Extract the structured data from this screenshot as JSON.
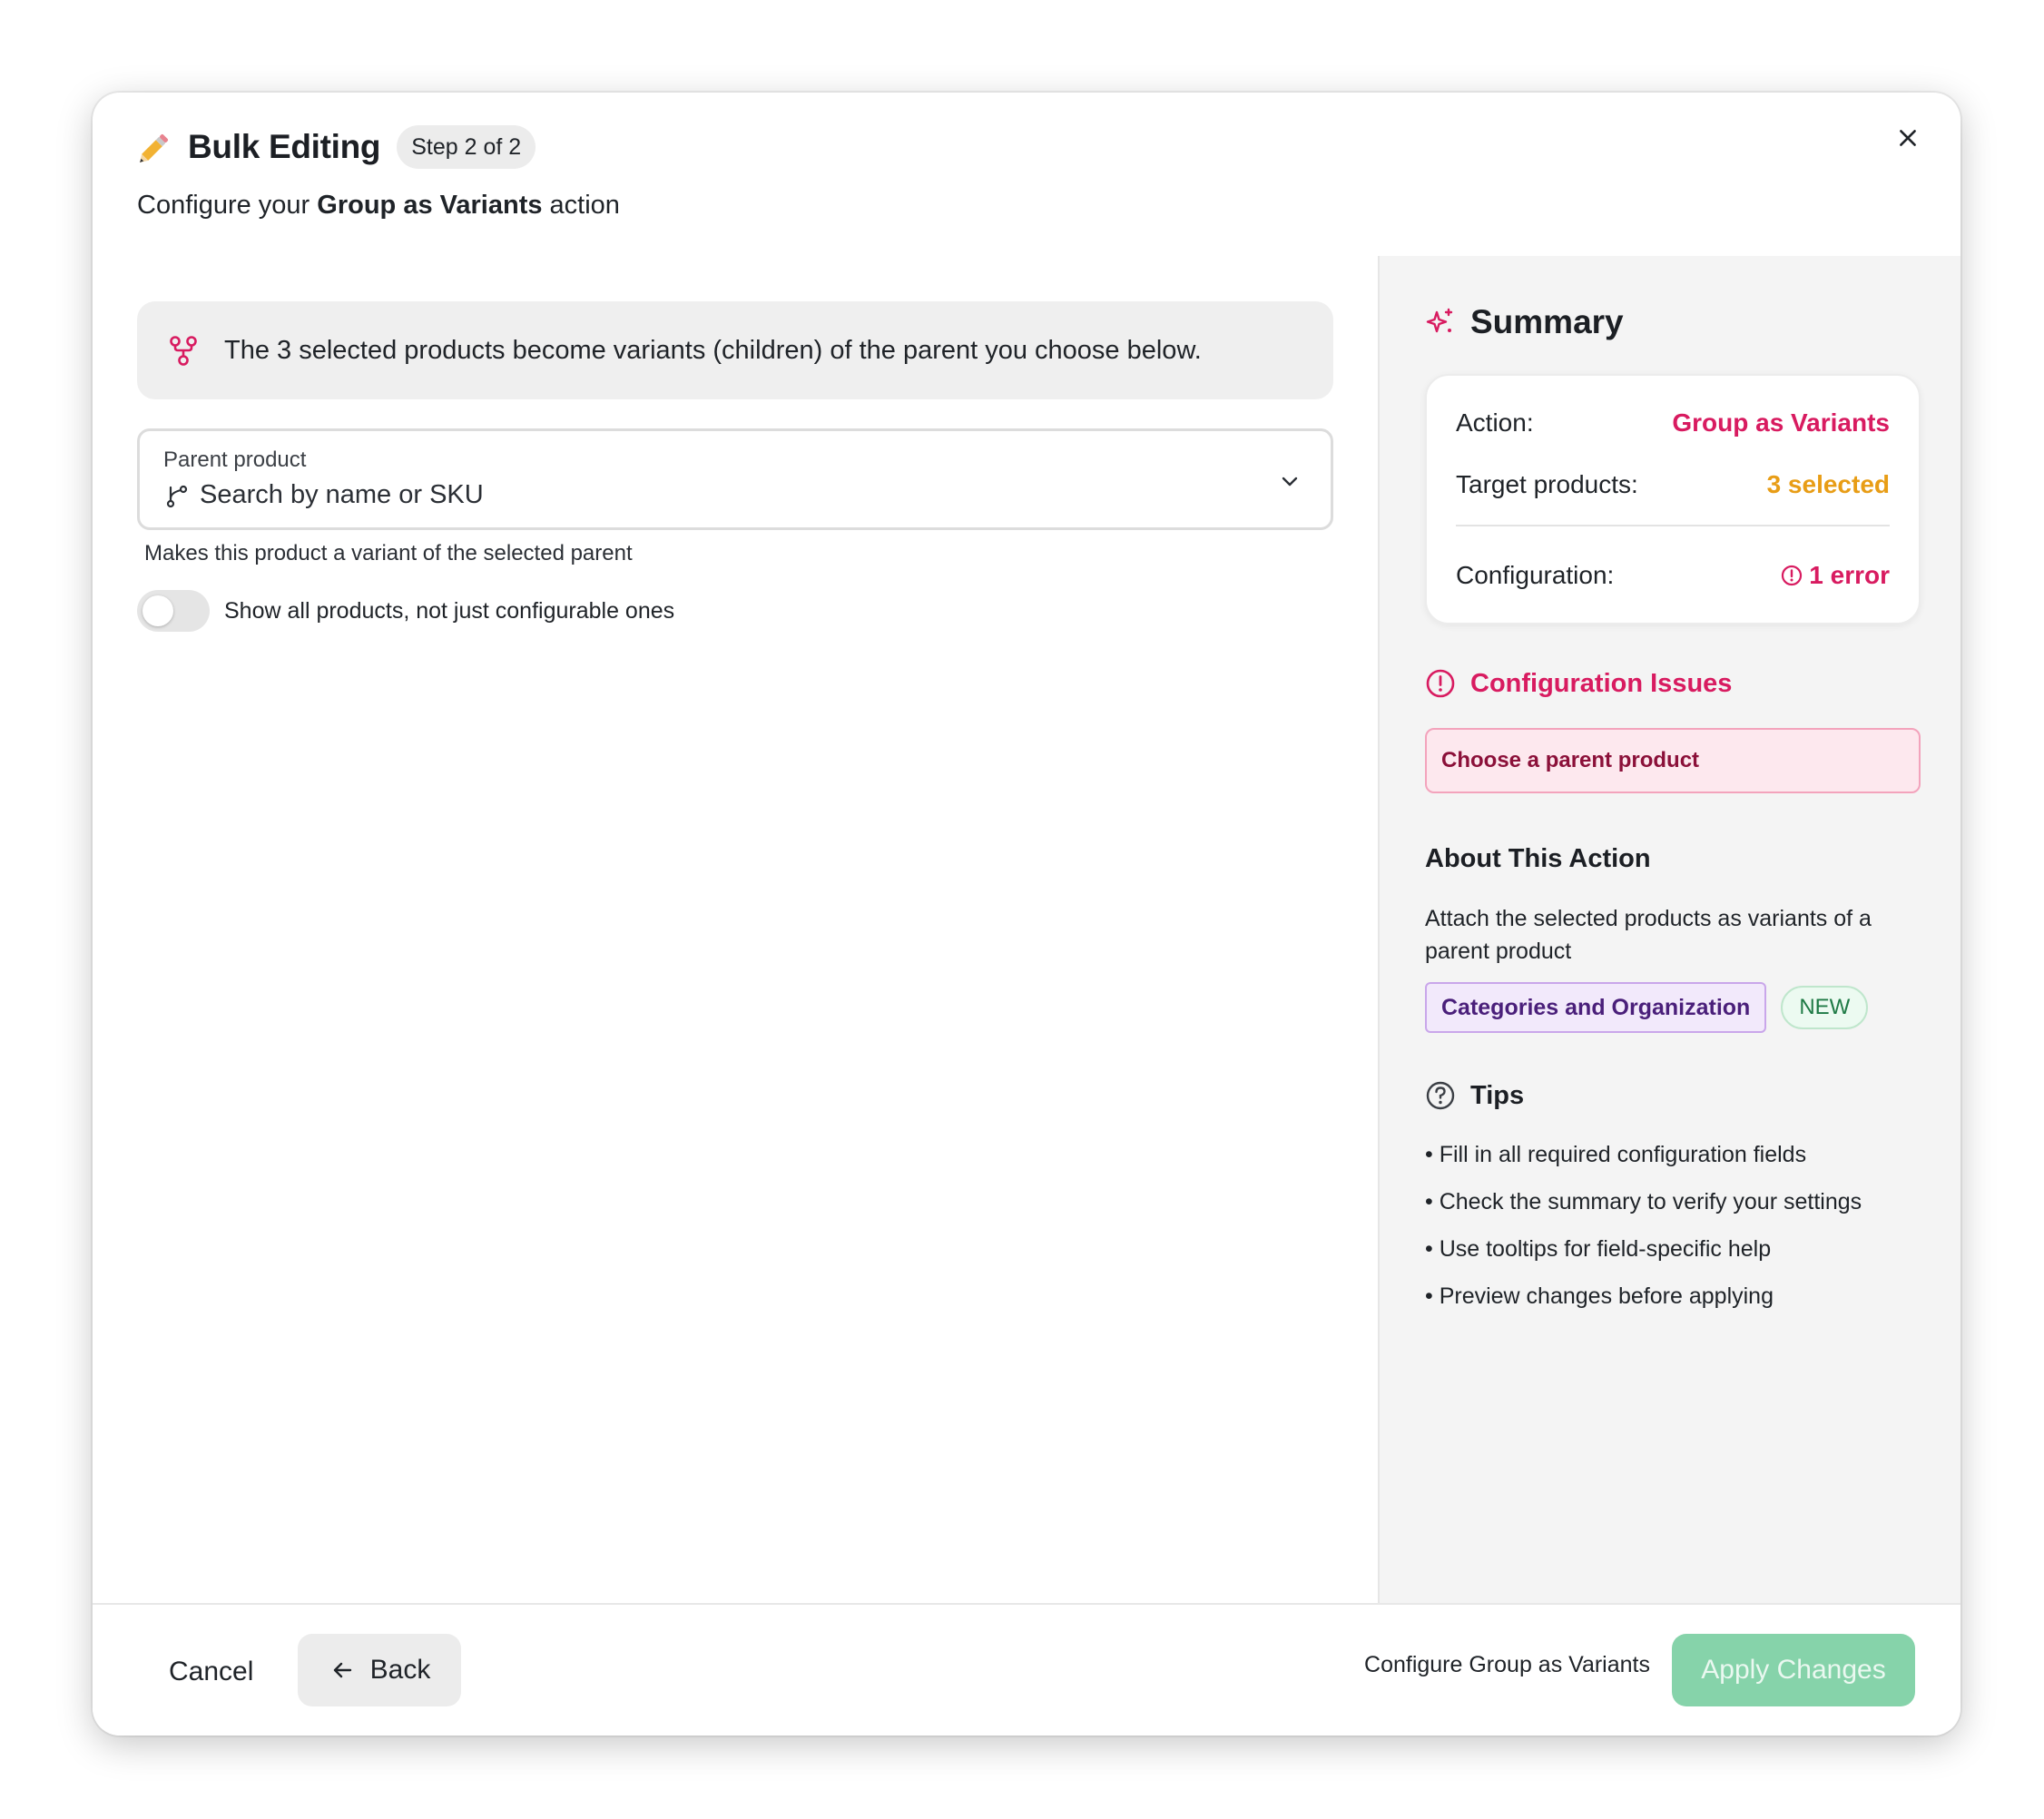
{
  "header": {
    "title": "Bulk Editing",
    "step_badge": "Step 2 of 2",
    "subtitle_prefix": "Configure your ",
    "subtitle_action": "Group as Variants",
    "subtitle_suffix": " action"
  },
  "info": {
    "text": "The 3 selected products become variants (children) of the parent you choose below."
  },
  "parent_field": {
    "label": "Parent product",
    "placeholder": "Search by name or SKU",
    "helper": "Makes this product a variant of the selected parent"
  },
  "toggle": {
    "label": "Show all products, not just configurable ones",
    "checked": false
  },
  "summary": {
    "title": "Summary",
    "action_label": "Action:",
    "action_value": "Group as Variants",
    "target_label": "Target products:",
    "target_value": "3 selected",
    "config_label": "Configuration:",
    "config_value": "1 error"
  },
  "issues": {
    "title": "Configuration Issues",
    "items": [
      "Choose a parent product"
    ]
  },
  "about": {
    "title": "About This Action",
    "description": "Attach the selected products as variants of a parent product",
    "category_tag": "Categories and Organization",
    "new_tag": "NEW"
  },
  "tips": {
    "title": "Tips",
    "items": [
      "• Fill in all required configuration fields",
      "• Check the summary to verify your settings",
      "• Use tooltips for field-specific help",
      "• Preview changes before applying"
    ]
  },
  "footer": {
    "cancel_label": "Cancel",
    "back_label": "Back",
    "hint": "Configure Group as Variants",
    "apply_label": "Apply Changes"
  },
  "colors": {
    "accent_pink": "#d81b60",
    "accent_orange": "#e89d16",
    "apply_green": "#86d3aa"
  },
  "icons": {
    "close": "close-icon",
    "pencil": "pencil-icon",
    "hierarchy": "hierarchy-icon",
    "branch": "git-branch-icon",
    "chevron": "chevron-down-icon",
    "sparkle": "sparkle-icon",
    "alert": "alert-circle-icon",
    "help": "help-circle-icon",
    "arrow_left": "arrow-left-icon"
  }
}
